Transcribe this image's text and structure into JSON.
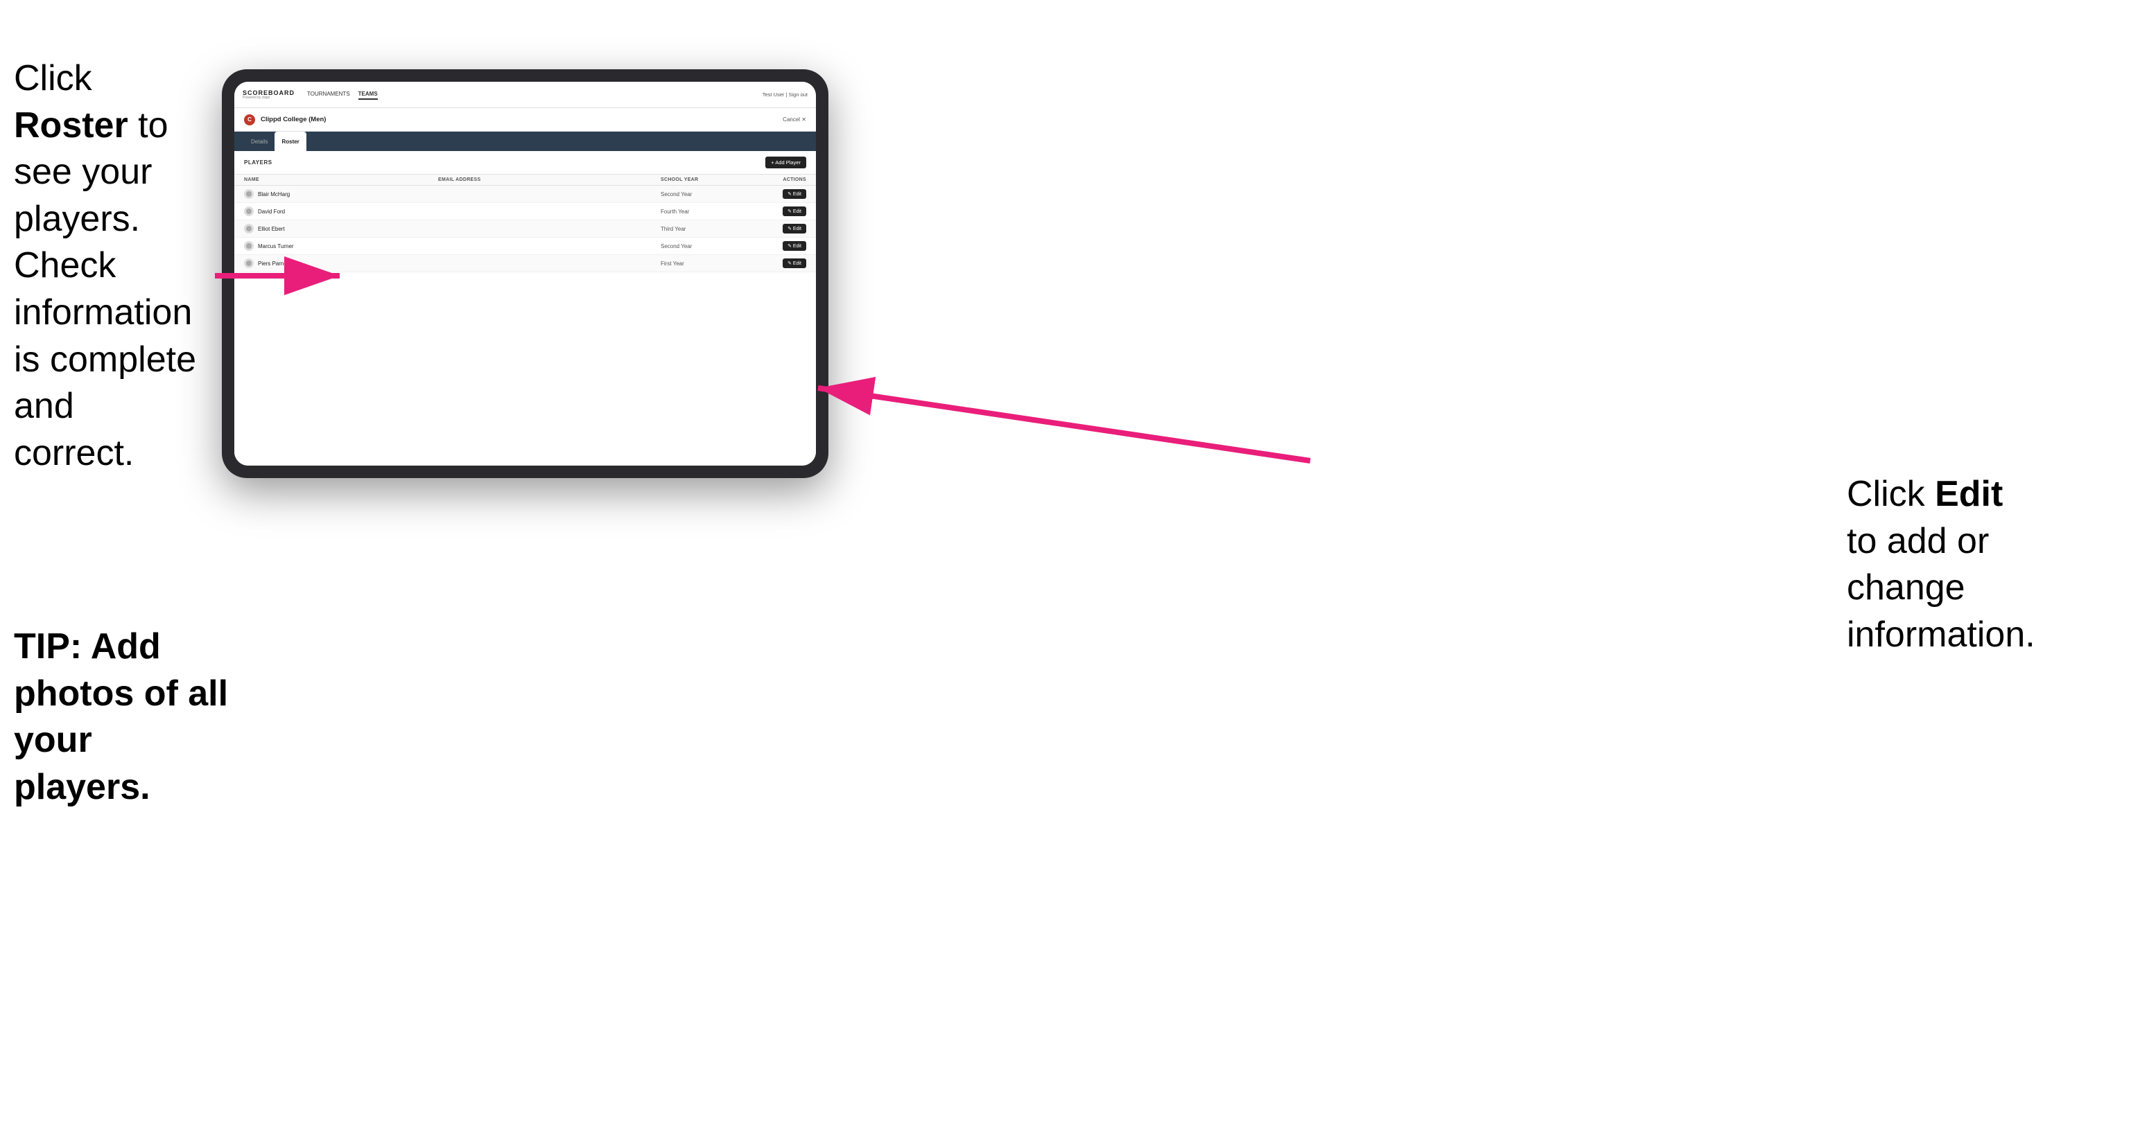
{
  "instruction_left": {
    "line1": "Click ",
    "bold1": "Roster",
    "line2": " to",
    "line3": "see your players.",
    "line4": "Check information",
    "line5": "is complete and",
    "line6": "correct."
  },
  "tip": {
    "text": "TIP: Add photos of all your players."
  },
  "instruction_right": {
    "line1": "Click ",
    "bold": "Edit",
    "line2": "to add or change",
    "line3": "information."
  },
  "navbar": {
    "logo": "SCOREBOARD",
    "logo_sub": "Powered by clippi",
    "nav_items": [
      "TOURNAMENTS",
      "TEAMS"
    ],
    "active_nav": "TEAMS",
    "user_text": "Test User | Sign out"
  },
  "team": {
    "logo_letter": "C",
    "name": "Clippd College (Men)",
    "cancel_label": "Cancel ✕"
  },
  "tabs": [
    {
      "label": "Details",
      "active": false
    },
    {
      "label": "Roster",
      "active": true
    }
  ],
  "players_section": {
    "label": "PLAYERS",
    "add_button": "+ Add Player"
  },
  "table": {
    "columns": [
      "NAME",
      "EMAIL ADDRESS",
      "SCHOOL YEAR",
      "ACTIONS"
    ],
    "rows": [
      {
        "name": "Blair McHarg",
        "email": "",
        "year": "Second Year",
        "edit": "Edit"
      },
      {
        "name": "David Ford",
        "email": "",
        "year": "Fourth Year",
        "edit": "Edit"
      },
      {
        "name": "Elliot Ebert",
        "email": "",
        "year": "Third Year",
        "edit": "Edit"
      },
      {
        "name": "Marcus Turner",
        "email": "",
        "year": "Second Year",
        "edit": "Edit"
      },
      {
        "name": "Piers Parnell",
        "email": "",
        "year": "First Year",
        "edit": "Edit"
      }
    ]
  }
}
